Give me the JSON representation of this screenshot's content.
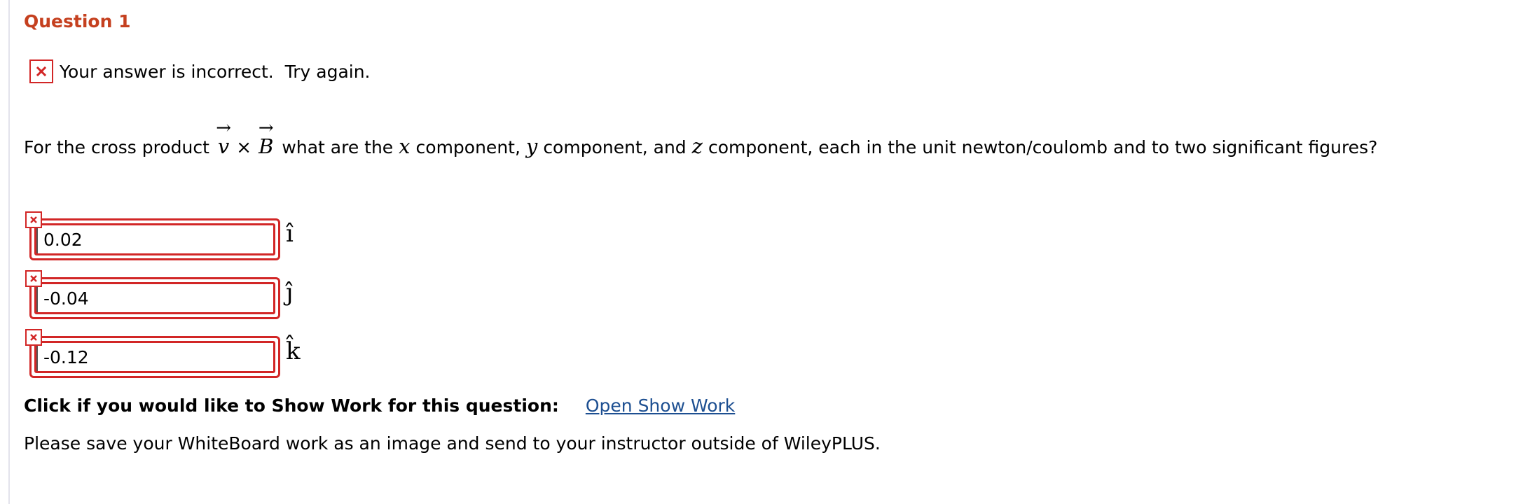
{
  "question": {
    "title": "Question 1",
    "feedback": "Your answer is incorrect.  Try again.",
    "prompt_prefix": "For the cross product",
    "vector_v": "v",
    "cross_operator": "×",
    "vector_B": "B",
    "prompt_part1": "what are the",
    "var_x": "x",
    "prompt_part2": "component,",
    "var_y": "y",
    "prompt_part3": "component, and",
    "var_z": "z",
    "prompt_part4": "component, each in the unit newton/coulomb and to two significant figures?"
  },
  "answers": [
    {
      "value": "0.02",
      "unit": "î",
      "status": "incorrect"
    },
    {
      "value": "-0.04",
      "unit": "ĵ",
      "status": "incorrect"
    },
    {
      "value": "-0.12",
      "unit": "k̂",
      "status": "incorrect"
    }
  ],
  "show_work": {
    "label": "Click if you would like to Show Work for this question:",
    "link": "Open Show Work"
  },
  "note": "Please save your WhiteBoard work as an image and send to your instructor outside of WileyPLUS.",
  "colors": {
    "title": "#c5401f",
    "error": "#d22626",
    "link": "#1d4f91"
  },
  "icons": {
    "feedback": "incorrect-x-icon",
    "field_status": "incorrect-x-icon"
  }
}
